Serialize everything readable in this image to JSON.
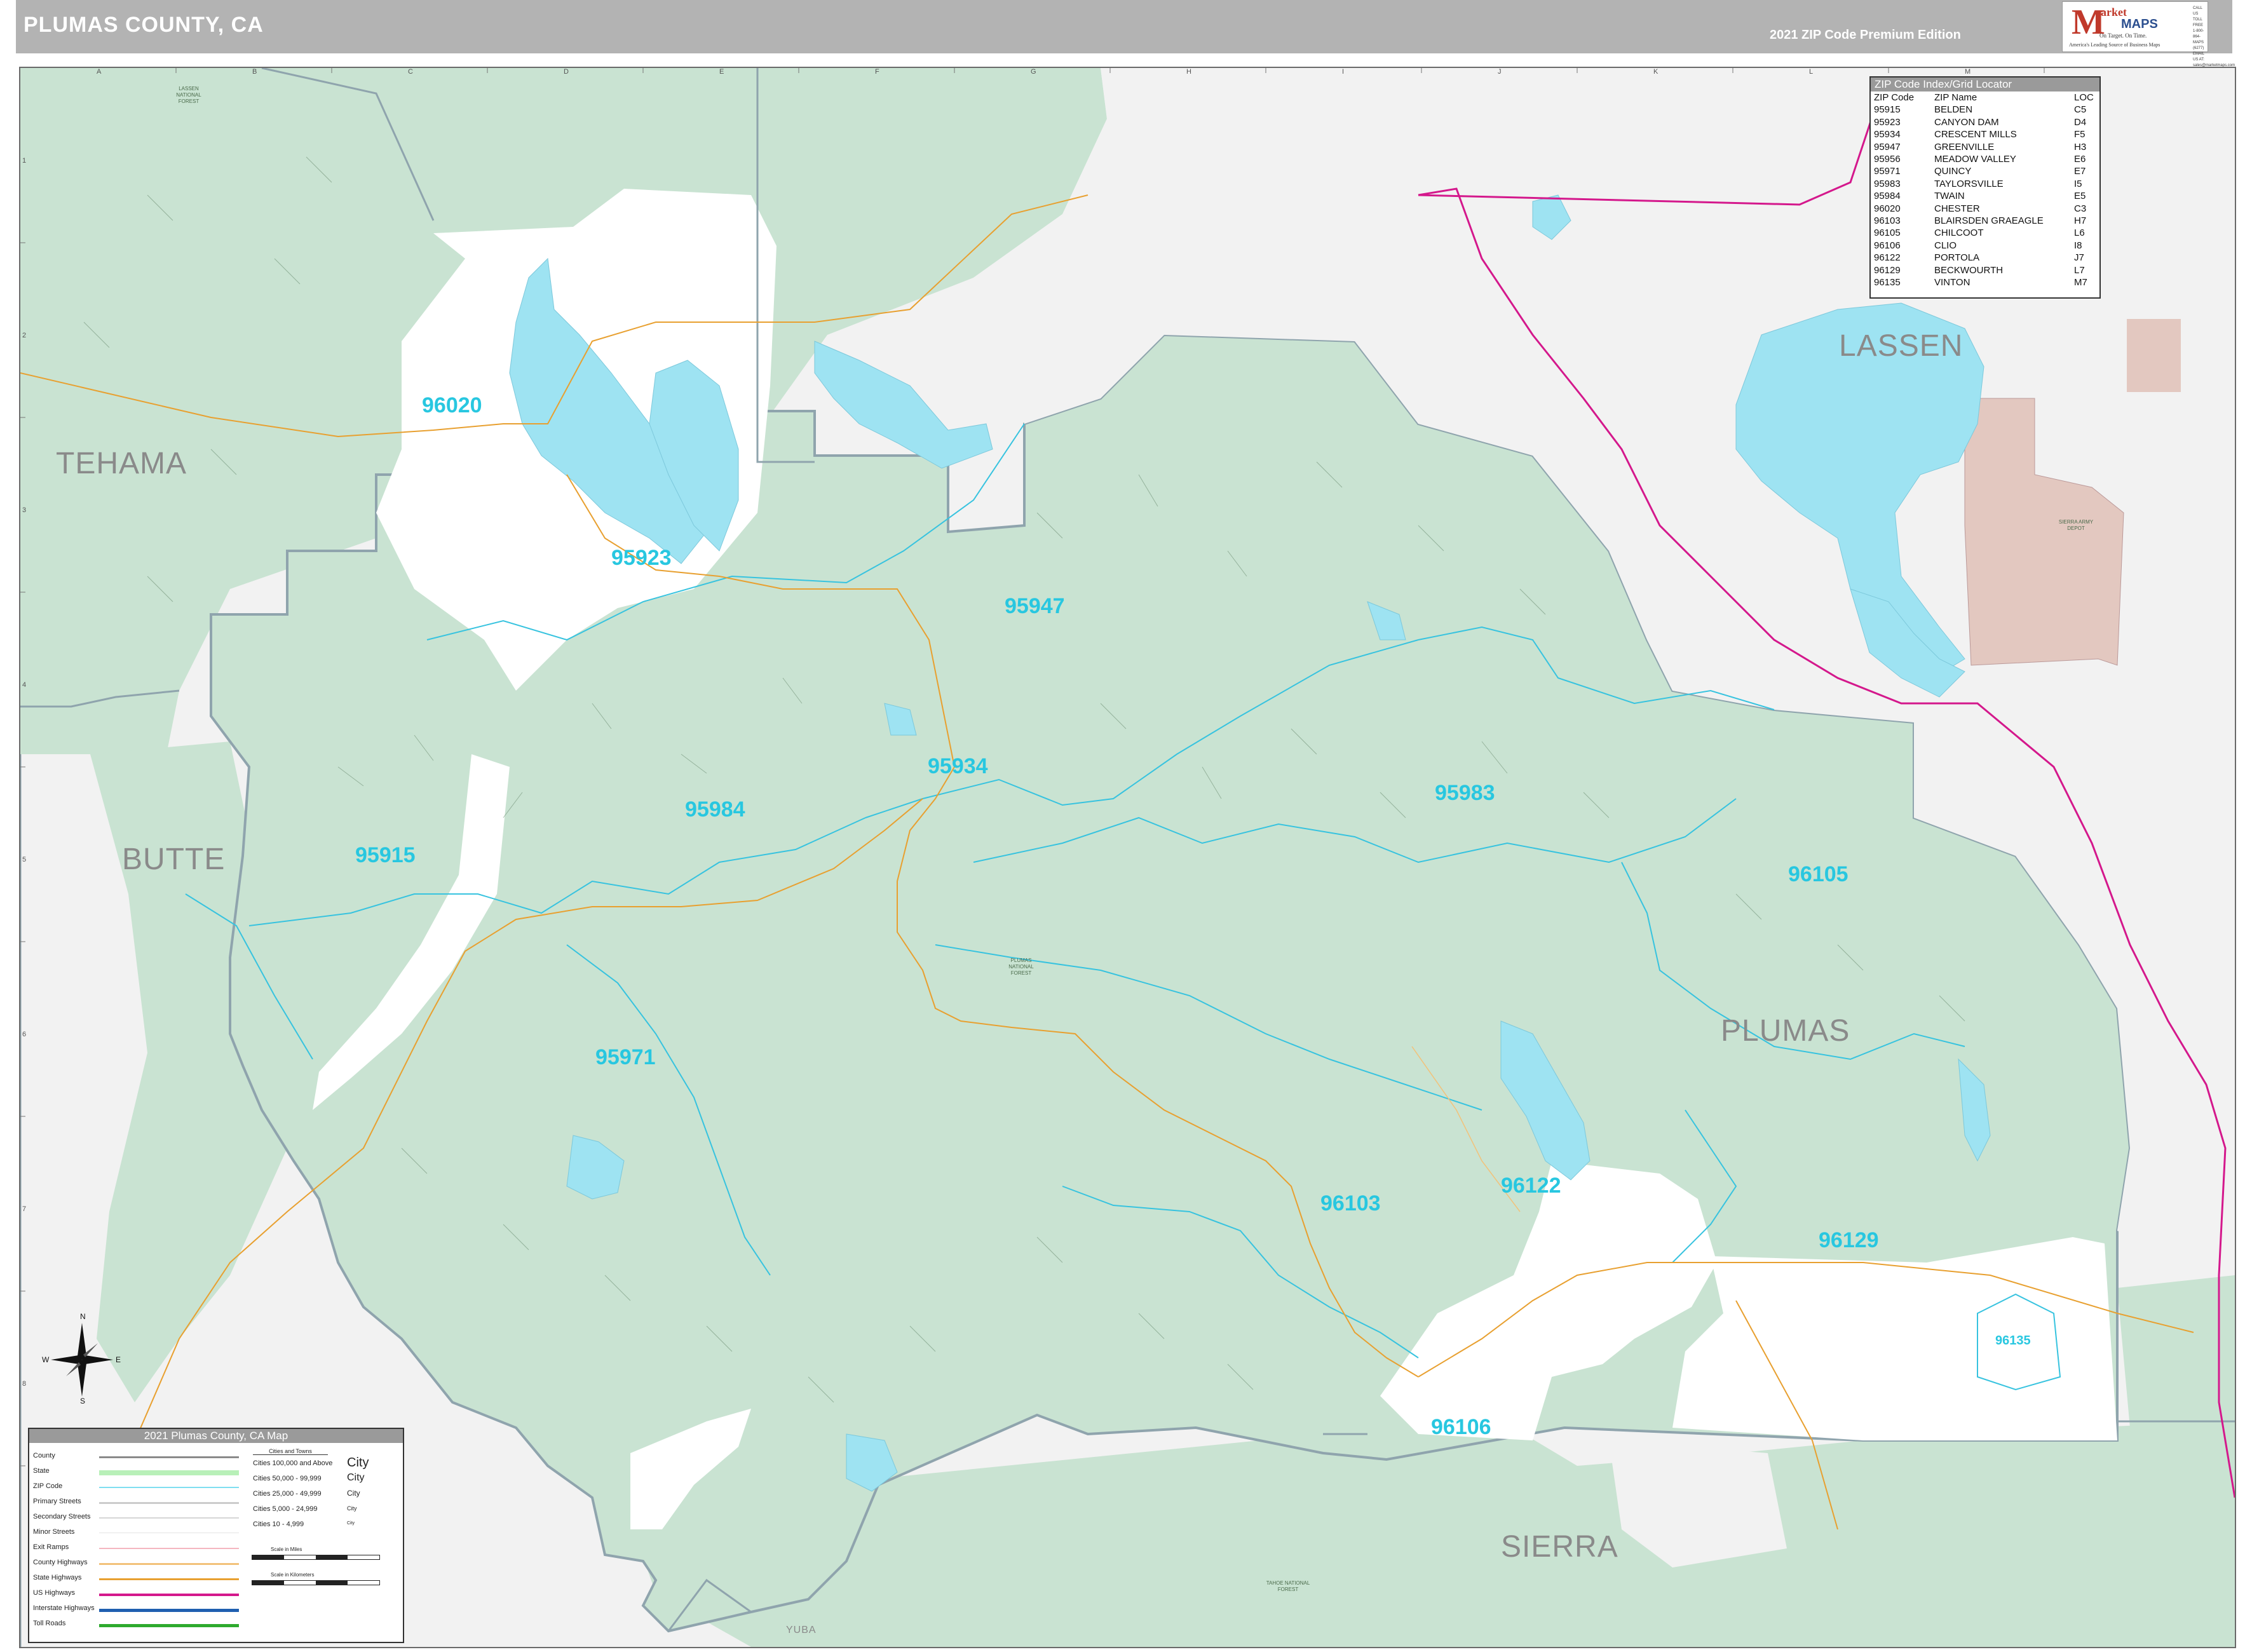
{
  "header": {
    "title": "PLUMAS COUNTY, CA",
    "edition": "2021 ZIP Code Premium Edition",
    "logo": {
      "brand_m": "M",
      "brand_market": "arket",
      "brand_maps": "MAPS",
      "tagline_1": "On Target. On Time.",
      "tagline_2": "America's Leading Source of Business Maps",
      "contact": "CALL US TOLL FREE 1-800-864-MAPS (6277) EMAIL US AT: sales@marketmaps.com"
    }
  },
  "grid": {
    "letters": [
      "A",
      "B",
      "C",
      "D",
      "E",
      "F",
      "G",
      "H",
      "I",
      "J",
      "K",
      "L",
      "M"
    ],
    "numbers": [
      "1",
      "2",
      "3",
      "4",
      "5",
      "6",
      "7",
      "8"
    ]
  },
  "county_labels": [
    "TEHAMA",
    "BUTTE",
    "LASSEN",
    "PLUMAS",
    "SIERRA",
    "YUBA"
  ],
  "zip_labels": [
    "96020",
    "95923",
    "95947",
    "95934",
    "95984",
    "95915",
    "95983",
    "96105",
    "95971",
    "96103",
    "96122",
    "96129",
    "96135",
    "96106"
  ],
  "forest_labels": [
    "LASSEN NATIONAL FOREST",
    "PLUMAS NATIONAL FOREST",
    "TAHOE NATIONAL FOREST",
    "SIERRA ARMY DEPOT"
  ],
  "zip_index": {
    "title": "ZIP Code Index/Grid Locator",
    "columns": [
      "ZIP Code",
      "ZIP Name",
      "LOC"
    ],
    "rows": [
      [
        "95915",
        "BELDEN",
        "C5"
      ],
      [
        "95923",
        "CANYON DAM",
        "D4"
      ],
      [
        "95934",
        "CRESCENT MILLS",
        "F5"
      ],
      [
        "95947",
        "GREENVILLE",
        "H3"
      ],
      [
        "95956",
        "MEADOW VALLEY",
        "E6"
      ],
      [
        "95971",
        "QUINCY",
        "E7"
      ],
      [
        "95983",
        "TAYLORSVILLE",
        "I5"
      ],
      [
        "95984",
        "TWAIN",
        "E5"
      ],
      [
        "96020",
        "CHESTER",
        "C3"
      ],
      [
        "96103",
        "BLAIRSDEN GRAEAGLE",
        "H7"
      ],
      [
        "96105",
        "CHILCOOT",
        "L6"
      ],
      [
        "96106",
        "CLIO",
        "I8"
      ],
      [
        "96122",
        "PORTOLA",
        "J7"
      ],
      [
        "96129",
        "BECKWOURTH",
        "L7"
      ],
      [
        "96135",
        "VINTON",
        "M7"
      ]
    ]
  },
  "legend": {
    "title": "2021 Plumas County, CA Map",
    "items": [
      {
        "label": "County",
        "color": "#8a8a8a"
      },
      {
        "label": "State",
        "color": "#b8f0b8"
      },
      {
        "label": "ZIP Code",
        "color": "#7fdff0"
      },
      {
        "label": "Primary Streets",
        "color": "#cccccc"
      },
      {
        "label": "Secondary Streets",
        "color": "#d6d6d6"
      },
      {
        "label": "Minor Streets",
        "color": "#e4e4e4"
      },
      {
        "label": "Exit Ramps",
        "color": "#f4b6c0"
      },
      {
        "label": "County Highways",
        "color": "#f2c27a"
      },
      {
        "label": "State Highways",
        "color": "#e8a030"
      },
      {
        "label": "US Highways",
        "color": "#d4188c"
      },
      {
        "label": "Interstate Highways",
        "color": "#1f5fb0"
      },
      {
        "label": "Toll Roads",
        "color": "#2eaa2e"
      }
    ],
    "cities_heading": "Cities and Towns",
    "cities": [
      {
        "label": "Cities 100,000 and Above",
        "sample": "City"
      },
      {
        "label": "Cities 50,000 - 99,999",
        "sample": "City"
      },
      {
        "label": "Cities 25,000 - 49,999",
        "sample": "City"
      },
      {
        "label": "Cities 5,000 - 24,999",
        "sample": "City"
      },
      {
        "label": "Cities 10 - 4,999",
        "sample": "City"
      }
    ],
    "scale_miles": "Scale in Miles",
    "scale_km": "Scale in Kilometers"
  },
  "compass": {
    "n": "N",
    "s": "S",
    "e": "E",
    "w": "W"
  },
  "colors": {
    "forest": "#c9e3d2",
    "plain": "#f2f2f2",
    "urban": "#ffffff",
    "water": "#9ee3f2",
    "zip_line": "#37c3df",
    "county_line": "#8fa4ad",
    "us_highway": "#d4188c",
    "state_highway": "#e8a030",
    "depot": "#e3c8c0"
  }
}
